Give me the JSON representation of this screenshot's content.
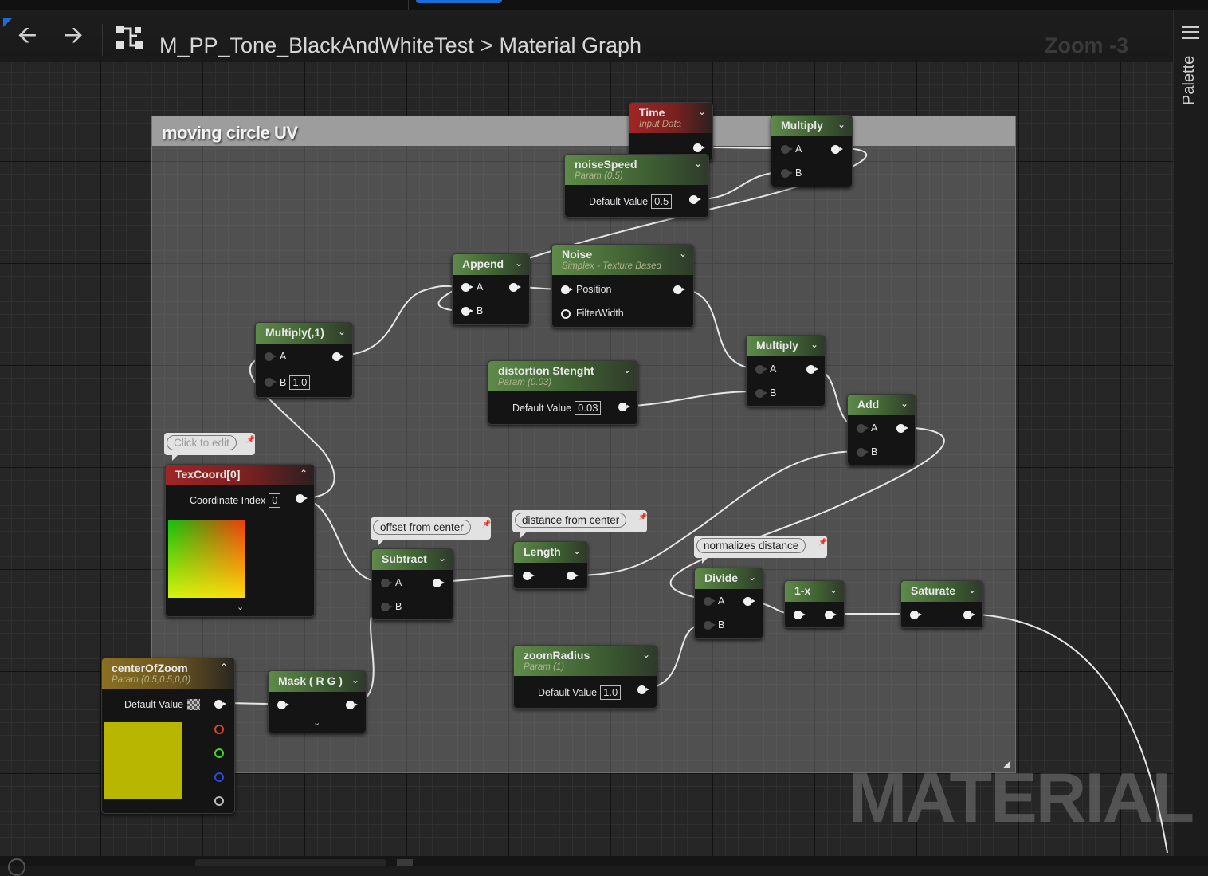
{
  "header": {
    "back_icon": "back-arrow-icon",
    "forward_icon": "forward-arrow-icon",
    "graph_icon": "material-graph-icon",
    "asset_name": "M_PP_Tone_BlackAndWhiteTest",
    "separator": ">",
    "graph_name": "Material Graph",
    "zoom": "Zoom -3"
  },
  "right_panel": {
    "label": "Palette",
    "icon": "palette-menu-icon"
  },
  "comment": {
    "title": "moving circle UV"
  },
  "watermark": "MATERIAL",
  "colors": {
    "accent": "#1a6fd6",
    "param_header": "#5e8a4a",
    "input_header": "#a02525",
    "vector_param_header": "#8a7020",
    "canvas": "#262626"
  },
  "bubbles": {
    "texcoord": "Click to edit",
    "subtract": "offset from center",
    "length": "distance from center",
    "divide": "normalizes distance"
  },
  "nodes": {
    "time": {
      "title": "Time",
      "subtitle": "Input Data"
    },
    "multiply_top": {
      "title": "Multiply",
      "pin_a": "A",
      "pin_b": "B"
    },
    "noise_speed": {
      "title": "noiseSpeed",
      "subtitle": "Param (0.5)",
      "default_label": "Default Value",
      "default_value": "0.5"
    },
    "append": {
      "title": "Append",
      "pin_a": "A",
      "pin_b": "B"
    },
    "noise": {
      "title": "Noise",
      "subtitle": "Simplex - Texture Based",
      "pin_position": "Position",
      "pin_filter": "FilterWidth"
    },
    "multiply_1": {
      "title": "Multiply(,1)",
      "pin_a": "A",
      "pin_b": "B",
      "b_value": "1.0"
    },
    "distortion": {
      "title": "distortion Stenght",
      "subtitle": "Param (0.03)",
      "default_label": "Default Value",
      "default_value": "0.03"
    },
    "multiply_mid": {
      "title": "Multiply",
      "pin_a": "A",
      "pin_b": "B"
    },
    "add": {
      "title": "Add",
      "pin_a": "A",
      "pin_b": "B"
    },
    "texcoord": {
      "title": "TexCoord[0]",
      "index_label": "Coordinate Index",
      "index_value": "0"
    },
    "subtract": {
      "title": "Subtract",
      "pin_a": "A",
      "pin_b": "B"
    },
    "length": {
      "title": "Length"
    },
    "divide": {
      "title": "Divide",
      "pin_a": "A",
      "pin_b": "B"
    },
    "one_minus": {
      "title": "1-x"
    },
    "saturate": {
      "title": "Saturate"
    },
    "zoom_radius": {
      "title": "zoomRadius",
      "subtitle": "Param (1)",
      "default_label": "Default Value",
      "default_value": "1.0"
    },
    "center_of_zoom": {
      "title": "centerOfZoom",
      "subtitle": "Param (0.5,0.5,0,0)",
      "default_label": "Default Value",
      "swatch_color": "#b9b600"
    },
    "mask": {
      "title": "Mask ( R G )"
    }
  }
}
